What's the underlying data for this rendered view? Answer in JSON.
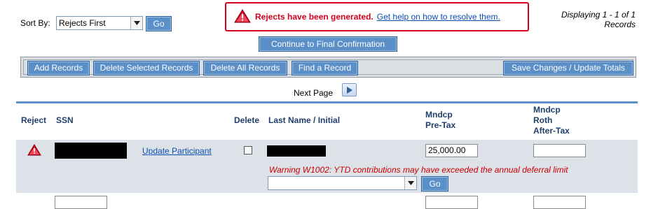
{
  "sort": {
    "label": "Sort By:",
    "selected": "Rejects First",
    "go_label": "Go"
  },
  "alert": {
    "message": "Rejects have been generated.",
    "help_link": "Get help on how to resolve them.",
    "color": "#d6001c"
  },
  "displaying": {
    "line1": "Displaying 1 - 1 of 1",
    "line2": "Records"
  },
  "final_confirm_label": "Continue to Final Confirmation",
  "toolbar": {
    "add_records": "Add Records",
    "delete_selected": "Delete Selected Records",
    "delete_all": "Delete All Records",
    "find_record": "Find a Record",
    "save_changes": "Save Changes / Update Totals"
  },
  "pagination": {
    "next_page_label": "Next Page"
  },
  "table": {
    "headers": {
      "reject": "Reject",
      "ssn": "SSN",
      "delete": "Delete",
      "last_name": "Last Name / Initial",
      "mndcp_pretax_1": "Mndcp",
      "mndcp_pretax_2": "Pre-Tax",
      "mndcp_roth_1": "Mndcp",
      "mndcp_roth_2": "Roth",
      "mndcp_roth_3": "After-Tax"
    },
    "rows": [
      {
        "update_link": "Update Participant",
        "pretax_value": "25,000.00",
        "roth_value": "",
        "warning": "Warning W1002: YTD contributions may have exceeded the annual deferral limit",
        "action_select": "",
        "action_go": "Go"
      }
    ]
  },
  "colors": {
    "accent": "#5a8fc8",
    "header_text": "#1f3f6a",
    "row_bg": "#dde2e9",
    "link": "#0b4fb3"
  },
  "icons": {
    "warning": "warning-triangle-icon",
    "next": "next-arrow-icon",
    "dropdown": "chevron-down-icon"
  }
}
